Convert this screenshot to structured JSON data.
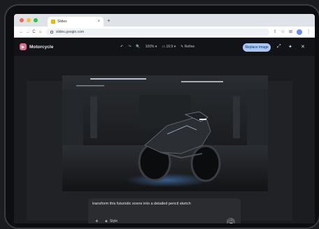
{
  "browser": {
    "tab_title": "Slides",
    "tab_close": "×",
    "new_tab": "+",
    "url": "slides.google.com",
    "traffic_colors": [
      "#ff5f57",
      "#febc2e",
      "#28c840"
    ]
  },
  "app": {
    "title": "Motorcycle",
    "logo_glyph": "▶",
    "zoom": "100%",
    "page_ratio": "16:9",
    "refine_label": "Refine",
    "replace_label": "Replace image",
    "accent": "#a8c7fa"
  },
  "icons": {
    "back": "←",
    "forward": "→",
    "reload": "C",
    "home": "⌂",
    "undo": "↶",
    "redo": "↷",
    "zoom": "🔍",
    "share": "⇧",
    "star": "☆",
    "extension": "⊞",
    "menu": "⋮",
    "expand": "⤢",
    "sparkle": "✦",
    "close": "✕",
    "plus": "+",
    "style": "◈",
    "send": "↑"
  },
  "prompt": {
    "text": "transform this futuristic scene into a detailed pencil sketch",
    "style_label": "Style"
  }
}
